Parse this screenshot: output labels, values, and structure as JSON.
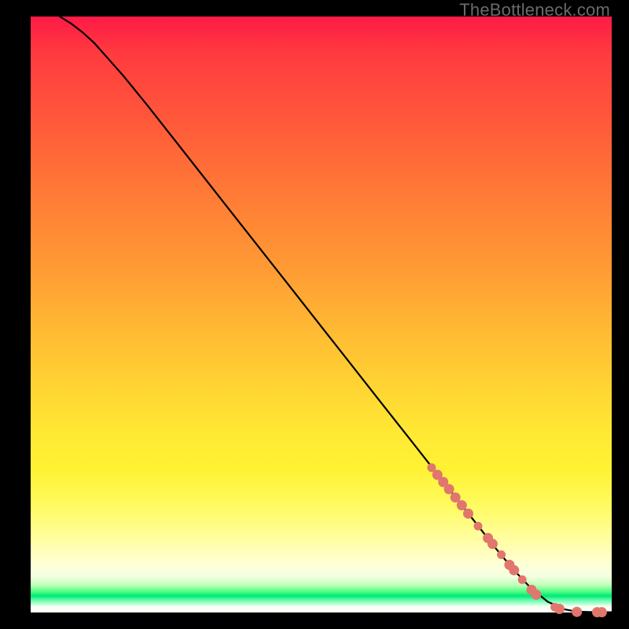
{
  "watermark": "TheBottleneck.com",
  "colors": {
    "dot": "#e0766d",
    "curve": "#000000"
  },
  "chart_data": {
    "type": "line",
    "title": "",
    "xlabel": "",
    "ylabel": "",
    "xlim": [
      0,
      100
    ],
    "ylim": [
      0,
      100
    ],
    "series": [
      {
        "name": "curve",
        "x": [
          5,
          7,
          9,
          11,
          13,
          16,
          20,
          25,
          30,
          35,
          40,
          45,
          50,
          55,
          60,
          65,
          70,
          75,
          80,
          83,
          86,
          89,
          92,
          94,
          96,
          98,
          100
        ],
        "y": [
          100,
          98.8,
          97.3,
          95.5,
          93.3,
          90.0,
          85.2,
          79.0,
          72.8,
          66.6,
          60.4,
          54.2,
          48.0,
          41.8,
          35.6,
          29.4,
          23.2,
          17.0,
          10.8,
          7.3,
          4.2,
          1.8,
          0.5,
          0.15,
          0.08,
          0.05,
          0.05
        ]
      }
    ],
    "scatter": [
      {
        "name": "dots",
        "points": [
          {
            "x": 69.0,
            "y": 24.3,
            "r": 5
          },
          {
            "x": 70.0,
            "y": 23.1,
            "r": 6
          },
          {
            "x": 71.0,
            "y": 21.9,
            "r": 6
          },
          {
            "x": 72.0,
            "y": 20.7,
            "r": 6
          },
          {
            "x": 73.1,
            "y": 19.3,
            "r": 6
          },
          {
            "x": 74.2,
            "y": 18.0,
            "r": 6
          },
          {
            "x": 75.3,
            "y": 16.6,
            "r": 6
          },
          {
            "x": 77.0,
            "y": 14.5,
            "r": 5
          },
          {
            "x": 78.7,
            "y": 12.5,
            "r": 6
          },
          {
            "x": 79.5,
            "y": 11.5,
            "r": 6
          },
          {
            "x": 81.0,
            "y": 9.7,
            "r": 5
          },
          {
            "x": 82.4,
            "y": 8.0,
            "r": 6
          },
          {
            "x": 83.2,
            "y": 7.1,
            "r": 6
          },
          {
            "x": 84.6,
            "y": 5.5,
            "r": 5
          },
          {
            "x": 86.2,
            "y": 3.8,
            "r": 6
          },
          {
            "x": 87.0,
            "y": 3.0,
            "r": 6
          },
          {
            "x": 90.2,
            "y": 0.9,
            "r": 5
          },
          {
            "x": 91.0,
            "y": 0.6,
            "r": 6
          },
          {
            "x": 94.0,
            "y": 0.1,
            "r": 6
          },
          {
            "x": 97.5,
            "y": 0.05,
            "r": 6
          },
          {
            "x": 98.3,
            "y": 0.05,
            "r": 6
          }
        ]
      }
    ]
  }
}
